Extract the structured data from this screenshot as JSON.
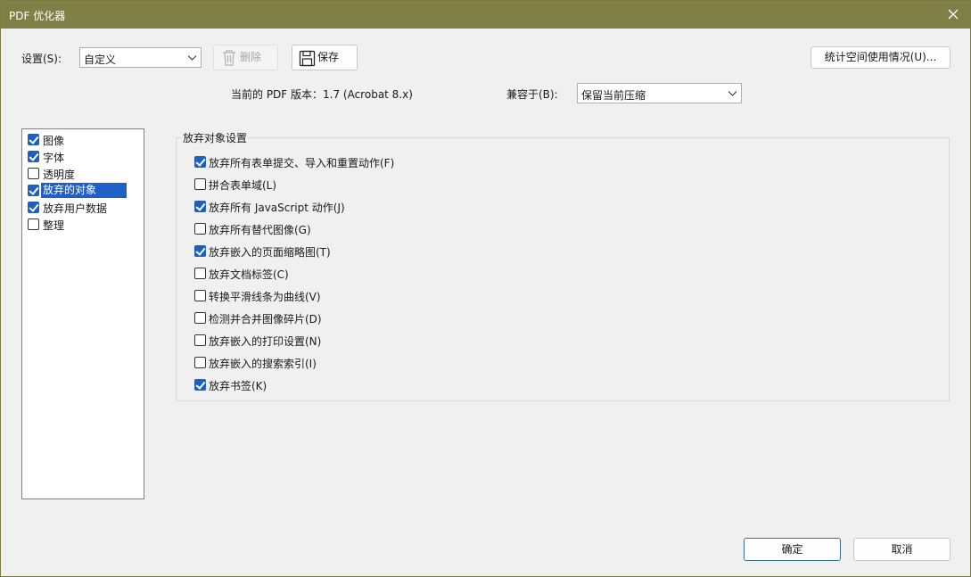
{
  "window": {
    "title": "PDF 优化器"
  },
  "toolbar": {
    "settings_label": "设置(S):",
    "settings_value": "自定义",
    "delete_label": "删除",
    "save_label": "保存",
    "audit_label": "统计空间使用情况(U)..."
  },
  "version": {
    "text": "当前的 PDF 版本：1.7 (Acrobat 8.x)",
    "compat_label": "兼容于(B):",
    "compat_value": "保留当前压缩"
  },
  "sidebar": {
    "items": [
      {
        "label": "图像",
        "checked": true,
        "selected": false
      },
      {
        "label": "字体",
        "checked": true,
        "selected": false
      },
      {
        "label": "透明度",
        "checked": false,
        "selected": false
      },
      {
        "label": "放弃的对象",
        "checked": true,
        "selected": true
      },
      {
        "label": "放弃用户数据",
        "checked": true,
        "selected": false
      },
      {
        "label": "整理",
        "checked": false,
        "selected": false
      }
    ]
  },
  "panel": {
    "title": "放弃对象设置",
    "options": [
      {
        "label": "放弃所有表单提交、导入和重置动作(F)",
        "checked": true
      },
      {
        "label": "拼合表单域(L)",
        "checked": false
      },
      {
        "label": "放弃所有 JavaScript 动作(J)",
        "checked": true
      },
      {
        "label": "放弃所有替代图像(G)",
        "checked": false
      },
      {
        "label": "放弃嵌入的页面缩略图(T)",
        "checked": true
      },
      {
        "label": "放弃文档标签(C)",
        "checked": false
      },
      {
        "label": "转换平滑线条为曲线(V)",
        "checked": false
      },
      {
        "label": "检测并合并图像碎片(D)",
        "checked": false
      },
      {
        "label": "放弃嵌入的打印设置(N)",
        "checked": false
      },
      {
        "label": "放弃嵌入的搜索索引(I)",
        "checked": false
      },
      {
        "label": "放弃书签(K)",
        "checked": true
      }
    ]
  },
  "footer": {
    "ok_label": "确定",
    "cancel_label": "取消"
  },
  "colors": {
    "titlebar": "#808046",
    "selection": "#1f60c8",
    "checkbox": "#1f5fbf"
  }
}
